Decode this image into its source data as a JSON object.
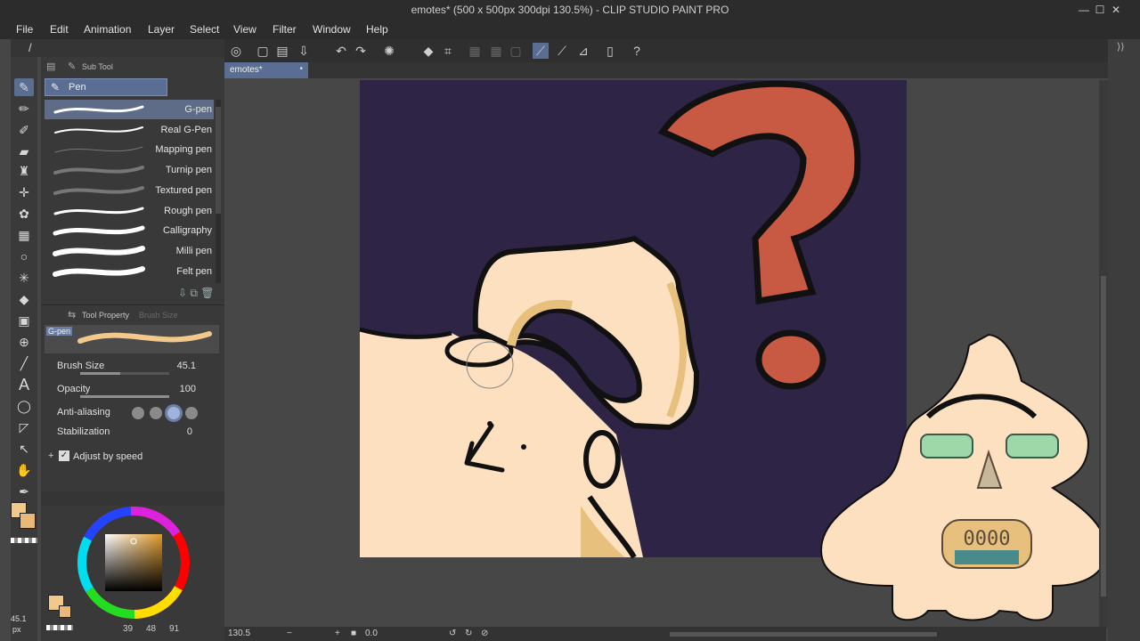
{
  "window": {
    "title": "emotes* (500 x 500px 300dpi 130.5%) - CLIP STUDIO PAINT PRO",
    "minimize": "—",
    "maximize": "☐",
    "close": "✕"
  },
  "menu": [
    "File",
    "Edit",
    "Animation",
    "Layer",
    "Select",
    "View",
    "Filter",
    "Window",
    "Help"
  ],
  "subtool": {
    "header": "Sub Tool",
    "active_group": "Pen",
    "brushes": [
      {
        "name": "G-pen",
        "selected": true
      },
      {
        "name": "Real G-Pen",
        "selected": false
      },
      {
        "name": "Mapping pen",
        "selected": false
      },
      {
        "name": "Turnip pen",
        "selected": false
      },
      {
        "name": "Textured pen",
        "selected": false
      },
      {
        "name": "Rough pen",
        "selected": false
      },
      {
        "name": "Calligraphy",
        "selected": false
      },
      {
        "name": "Milli pen",
        "selected": false
      },
      {
        "name": "Felt pen",
        "selected": false
      }
    ]
  },
  "tool_property": {
    "header": "Tool Property",
    "inactive_tab": "Brush Size",
    "preview_label": "G-pen",
    "brush_size_label": "Brush Size",
    "brush_size": "45.1",
    "opacity_label": "Opacity",
    "opacity": "100",
    "anti_aliasing_label": "Anti-aliasing",
    "anti_aliasing_level": 2,
    "stabilization_label": "Stabilization",
    "stabilization": "0",
    "adjust_by_speed_label": "Adjust by speed",
    "adjust_by_speed_checked": true
  },
  "colors": {
    "main": "#f2c98a",
    "sub": "#e9b97a",
    "accent": "#5a6e94",
    "canvas_bg": "#2e2446",
    "skin": "#fde0bf",
    "skin_shadow": "#e8c07e",
    "question": "#c85a43"
  },
  "color_readout": {
    "r": "39",
    "g": "48",
    "b": "91"
  },
  "side_brush_size": "45.1",
  "side_brush_unit": "px",
  "document_tab": "emotes*",
  "status": {
    "zoom": "130.5",
    "angle": "0.0"
  },
  "icons": [
    "new-file-icon",
    "open-icon",
    "save-icon",
    "undo-icon",
    "redo-icon",
    "transform-icon",
    "fill-icon",
    "snap-icon",
    "ruler-icon",
    "help-icon"
  ]
}
